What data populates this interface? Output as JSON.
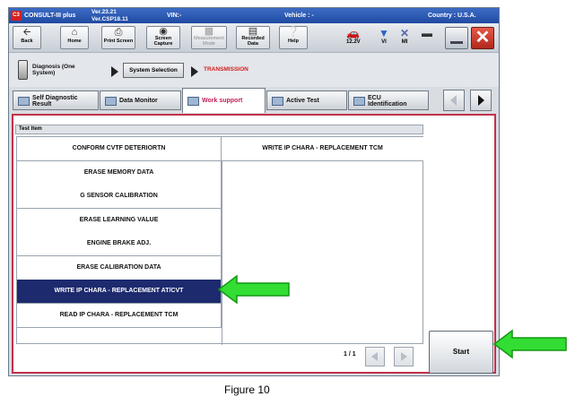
{
  "title_bar": {
    "app_name": "CONSULT-III plus",
    "version_line1": "Ver.23.21",
    "version_line2": "Ver.CSP18.11",
    "vin": "VIN:-",
    "vehicle": "Vehicle : -",
    "country": "Country : U.S.A."
  },
  "toolbar": {
    "back": "Back",
    "home": "Home",
    "print_screen": "Print Screen",
    "screen_capture_1": "Screen",
    "screen_capture_2": "Capture",
    "measurement_1": "Measurement",
    "measurement_2": "Mode",
    "recorded_1": "Recorded",
    "recorded_2": "Data",
    "help": "Help",
    "voltage": "12.2V",
    "vi": "VI",
    "mi": "MI"
  },
  "breadcrumb": {
    "step1_line1": "Diagnosis (One",
    "step1_line2": "System)",
    "step2": "System Selection",
    "step3": "TRANSMISSION"
  },
  "tabs": {
    "self_diag_1": "Self Diagnostic",
    "self_diag_2": "Result",
    "data_monitor": "Data Monitor",
    "work_support": "Work support",
    "active_test": "Active Test",
    "ecu_id_1": "ECU",
    "ecu_id_2": "Identification"
  },
  "table": {
    "header": "Test Item",
    "left_items": [
      "CONFORM CVTF DETERIORTN",
      "ERASE MEMORY DATA",
      "G SENSOR CALIBRATION",
      "ERASE LEARNING VALUE",
      "ENGINE BRAKE ADJ.",
      "ERASE CALIBRATION DATA",
      "WRITE IP CHARA - REPLACEMENT AT/CVT",
      "READ IP CHARA - REPLACEMENT TCM"
    ],
    "right_items": [
      "WRITE IP CHARA - REPLACEMENT TCM"
    ],
    "selected_index": 6
  },
  "pager": {
    "text": "1 / 1"
  },
  "start_button": "Start",
  "caption": "Figure 10",
  "colors": {
    "selected_row": "#1d2a6e",
    "panel_border": "#c2304a",
    "callout_arrow": "#33dd33",
    "breadcrumb_current": "#d61d1d"
  }
}
